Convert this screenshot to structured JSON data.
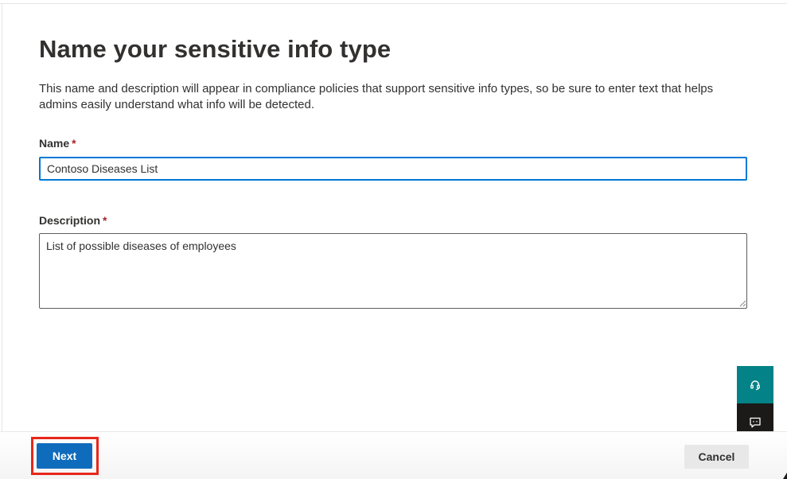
{
  "header": {
    "title": "Name your sensitive info type",
    "description": "This name and description will appear in compliance policies that support sensitive info types, so be sure to enter text that helps admins easily understand what info will be detected."
  },
  "form": {
    "name": {
      "label": "Name",
      "required_mark": "*",
      "value": "Contoso Diseases List"
    },
    "description": {
      "label": "Description",
      "required_mark": "*",
      "value": "List of possible diseases of employees"
    }
  },
  "footer": {
    "next_label": "Next",
    "cancel_label": "Cancel"
  },
  "side_actions": {
    "help_icon": "headset-icon",
    "feedback_icon": "chat-feedback-icon"
  },
  "colors": {
    "accent": "#0f6cbd",
    "focus_border": "#0078d4",
    "required": "#a4262c",
    "help_bg": "#038387",
    "feedback_bg": "#1b1a19",
    "highlight": "#e8271a"
  }
}
